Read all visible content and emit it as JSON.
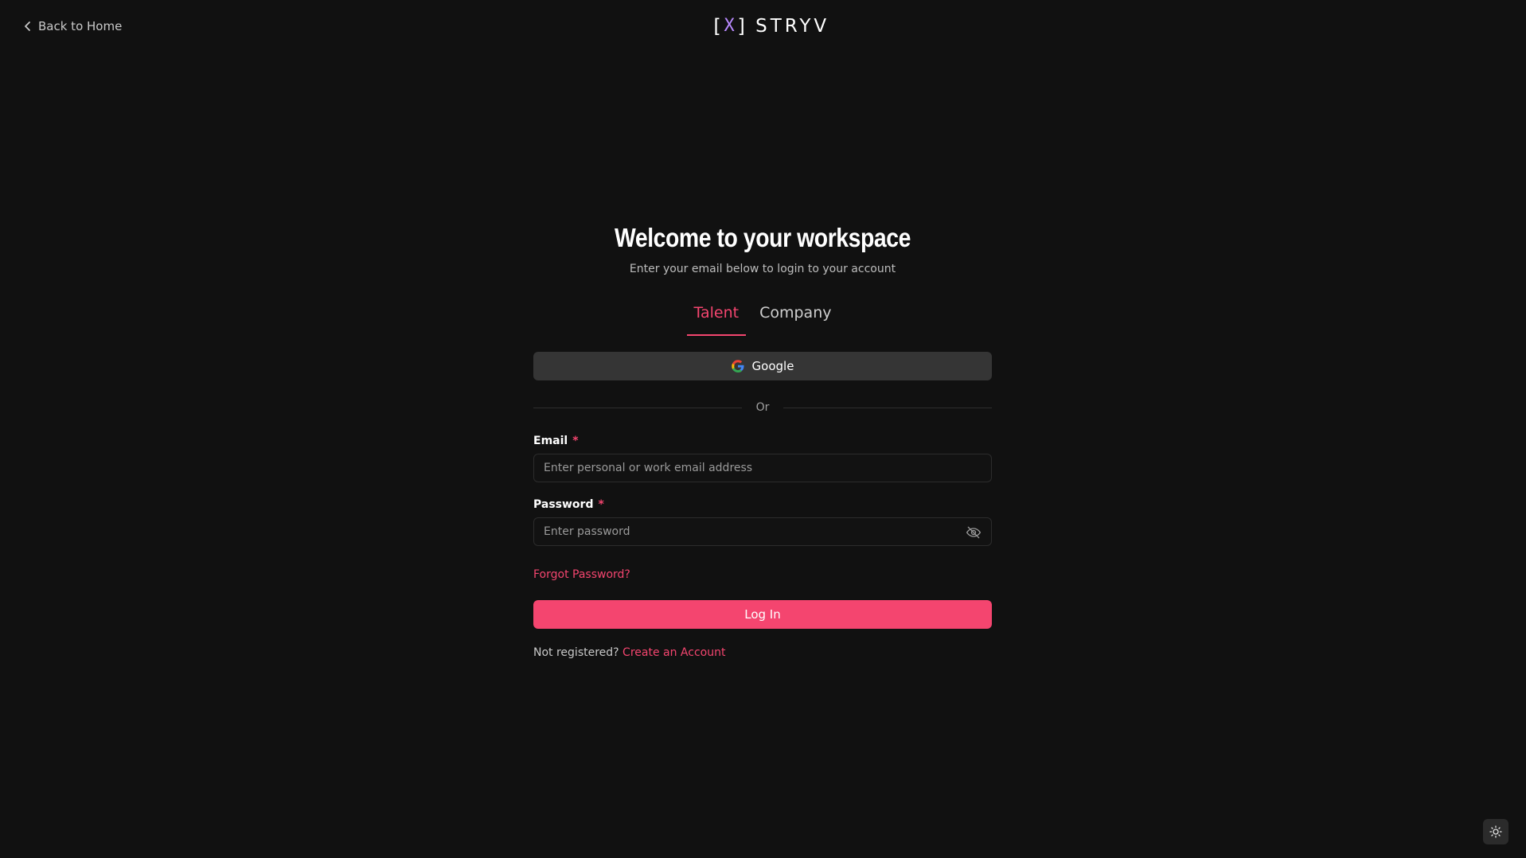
{
  "header": {
    "back_label": "Back to Home",
    "logo_text": "STRYV",
    "logo_mark_left": "[",
    "logo_mark_x": "X",
    "logo_mark_right": "]"
  },
  "form": {
    "title": "Welcome to your workspace",
    "subtitle": "Enter your email below to login to your account",
    "tabs": [
      {
        "label": "Talent",
        "active": true
      },
      {
        "label": "Company",
        "active": false
      }
    ],
    "google_label": "Google",
    "divider_label": "Or",
    "email": {
      "label": "Email",
      "required_mark": "*",
      "placeholder": "Enter personal or work email address"
    },
    "password": {
      "label": "Password",
      "required_mark": "*",
      "placeholder": "Enter password"
    },
    "forgot_label": "Forgot Password?",
    "login_label": "Log In",
    "register_prompt": "Not registered?",
    "register_link": "Create an Account"
  },
  "colors": {
    "background": "#111111",
    "accent": "#f4456f",
    "button_secondary": "#353535"
  },
  "icons": {
    "back": "chevron-left-icon",
    "google": "google-icon",
    "eye": "eye-off-icon",
    "theme": "sun-icon"
  }
}
